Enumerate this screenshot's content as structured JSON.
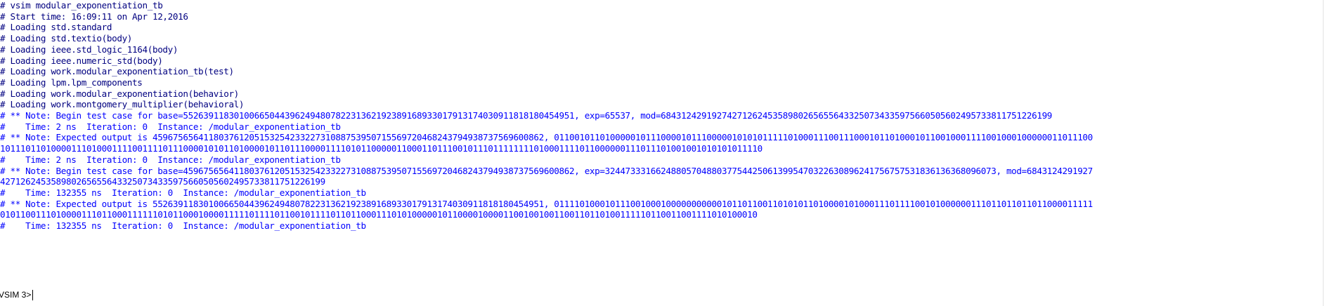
{
  "transcript": {
    "lines": [
      {
        "text": "# vsim modular_exponentiation_tb",
        "style": "normal"
      },
      {
        "text": "# Start time: 16:09:11 on Apr 12,2016",
        "style": "normal"
      },
      {
        "text": "# Loading std.standard",
        "style": "normal"
      },
      {
        "text": "# Loading std.textio(body)",
        "style": "normal"
      },
      {
        "text": "# Loading ieee.std_logic_1164(body)",
        "style": "normal"
      },
      {
        "text": "# Loading ieee.numeric_std(body)",
        "style": "normal"
      },
      {
        "text": "# Loading work.modular_exponentiation_tb(test)",
        "style": "normal"
      },
      {
        "text": "# Loading lpm.lpm_components",
        "style": "normal"
      },
      {
        "text": "# Loading work.modular_exponentiation(behavior)",
        "style": "normal"
      },
      {
        "text": "# Loading work.montgomery_multiplier(behavioral)",
        "style": "normal"
      },
      {
        "text": "# ** Note: Begin test case for base=55263911830100665044396249480782231362192389168933017913174030911818180454951, exp=65537, mod=68431242919274271262453589802656556433250734335975660505602495733811751226199",
        "style": "note"
      },
      {
        "text": "#    Time: 2 ns  Iteration: 0  Instance: /modular_exponentiation_tb",
        "style": "note"
      },
      {
        "text": "# ** Note: Expected output is 45967565641180376120515325423322731088753950715569720468243794938737569600862, 0110010110100000101110000101110000010101011111010001110011100010110100010110010001111001000100000011011100",
        "style": "note"
      },
      {
        "text": "101110110100001110100011110011110111000010101101000010110111000011110101100000110001101110010111011111111010001111011000000111011101001001010101011110",
        "style": "note"
      },
      {
        "text": "#    Time: 2 ns  Iteration: 0  Instance: /modular_exponentiation_tb",
        "style": "note"
      },
      {
        "text": "# ** Note: Begin test case for base=45967565641180376120515325423322731088753950715569720468243794938737569600862, exp=32447333166248805704880377544250613995470322630896241756757531836136368096073, mod=6843124291927",
        "style": "note"
      },
      {
        "text": "4271262453589802656556433250734335975660505602495733811751226199",
        "style": "note"
      },
      {
        "text": "#    Time: 132355 ns  Iteration: 0  Instance: /modular_exponentiation_tb",
        "style": "note"
      },
      {
        "text": "# ** Note: Expected output is 55263911830100665044396249480782231362192389168933017913174030911818180454951, 0111101000101110010001000000000001011011001101010110100001010001110111100101000000111011011011011000011111",
        "style": "note"
      },
      {
        "text": "01011001110100001110110001111110101100010000111110111101100101111011011000111010100000101100001000011001001001100110110100111110110011001111010100010",
        "style": "note"
      },
      {
        "text": "#    Time: 132355 ns  Iteration: 0  Instance: /modular_exponentiation_tb",
        "style": "note"
      }
    ]
  },
  "prompt": {
    "label": "VSIM 3>"
  },
  "colors": {
    "normal_text": "#000080",
    "note_text": "#0000ff",
    "background": "#ffffff"
  }
}
